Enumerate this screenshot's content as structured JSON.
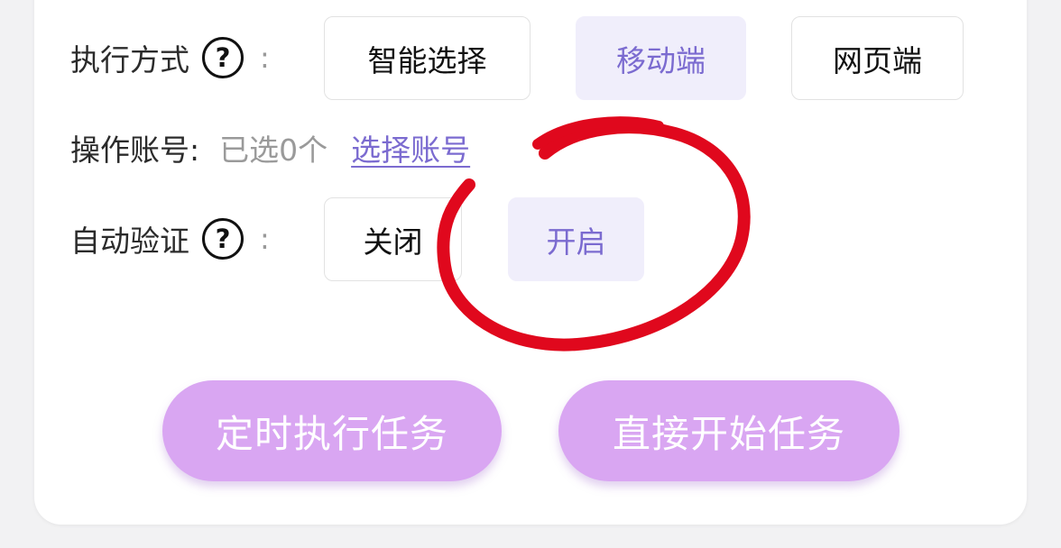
{
  "exec_mode": {
    "label": "执行方式",
    "help_icon": "question-circle-icon",
    "colon": ":",
    "options": [
      "智能选择",
      "移动端",
      "网页端"
    ],
    "selected": "移动端"
  },
  "account": {
    "label": "操作账号:",
    "selected_text": "已选0个",
    "select_link": "选择账号"
  },
  "auto_verify": {
    "label": "自动验证",
    "help_icon": "question-circle-icon",
    "colon": ":",
    "options": [
      "关闭",
      "开启"
    ],
    "selected": "开启"
  },
  "buttons": {
    "schedule": "定时执行任务",
    "start": "直接开始任务"
  },
  "colors": {
    "accent": "#7b6bd0",
    "active_bg": "#f0eefb",
    "primary_button": "#d9a6f2",
    "annotation": "#e0081d"
  }
}
